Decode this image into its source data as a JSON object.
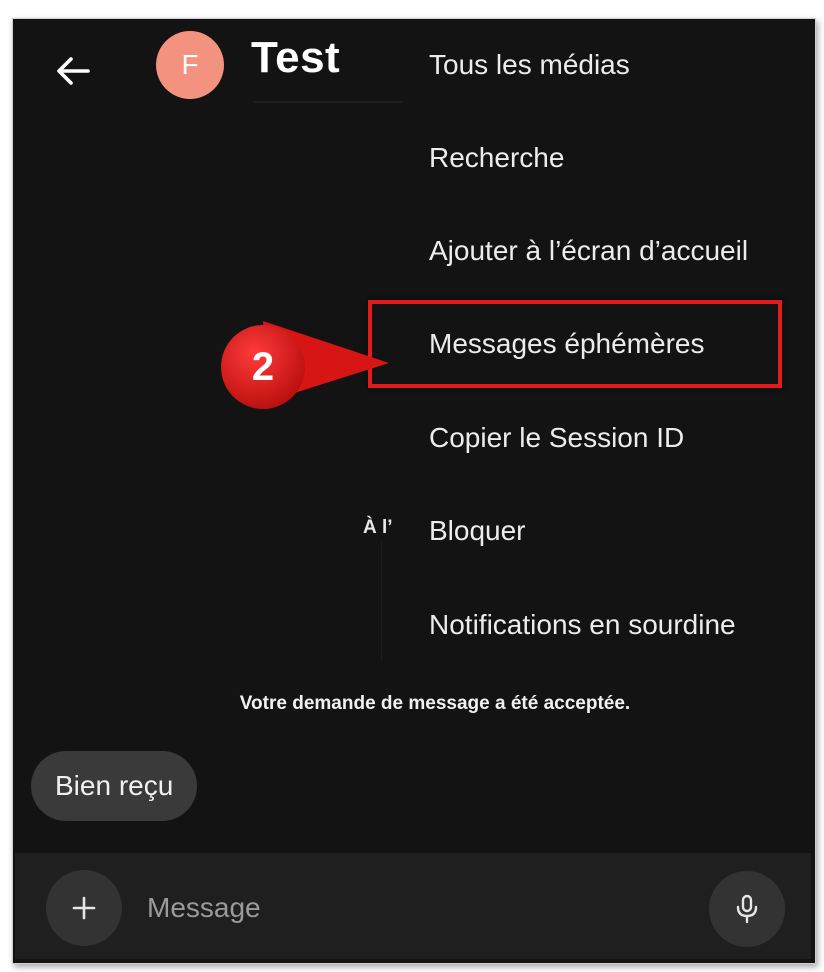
{
  "header": {
    "avatar_initial": "F",
    "title": "Test",
    "back_icon": "arrow-left-icon"
  },
  "menu": {
    "items": [
      {
        "label": "Tous les médias"
      },
      {
        "label": "Recherche"
      },
      {
        "label": "Ajouter à l’écran d’accueil"
      },
      {
        "label": "Messages éphémères"
      },
      {
        "label": "Copier le Session ID"
      },
      {
        "label": "Bloquer"
      },
      {
        "label": "Notifications en sourdine"
      }
    ]
  },
  "annotation": {
    "step_number": "2",
    "color": "#e21c1c"
  },
  "background_fragment": "À l’",
  "chat": {
    "system_message": "Votre demande de message a été acceptée.",
    "messages": [
      {
        "text": "Bien reçu"
      }
    ]
  },
  "composer": {
    "placeholder": "Message",
    "add_icon": "plus-icon",
    "mic_icon": "microphone-icon"
  },
  "colors": {
    "background": "#131313",
    "avatar": "#f2927f",
    "bubble": "#3a3a3a",
    "composer": "#1f1f1f"
  }
}
